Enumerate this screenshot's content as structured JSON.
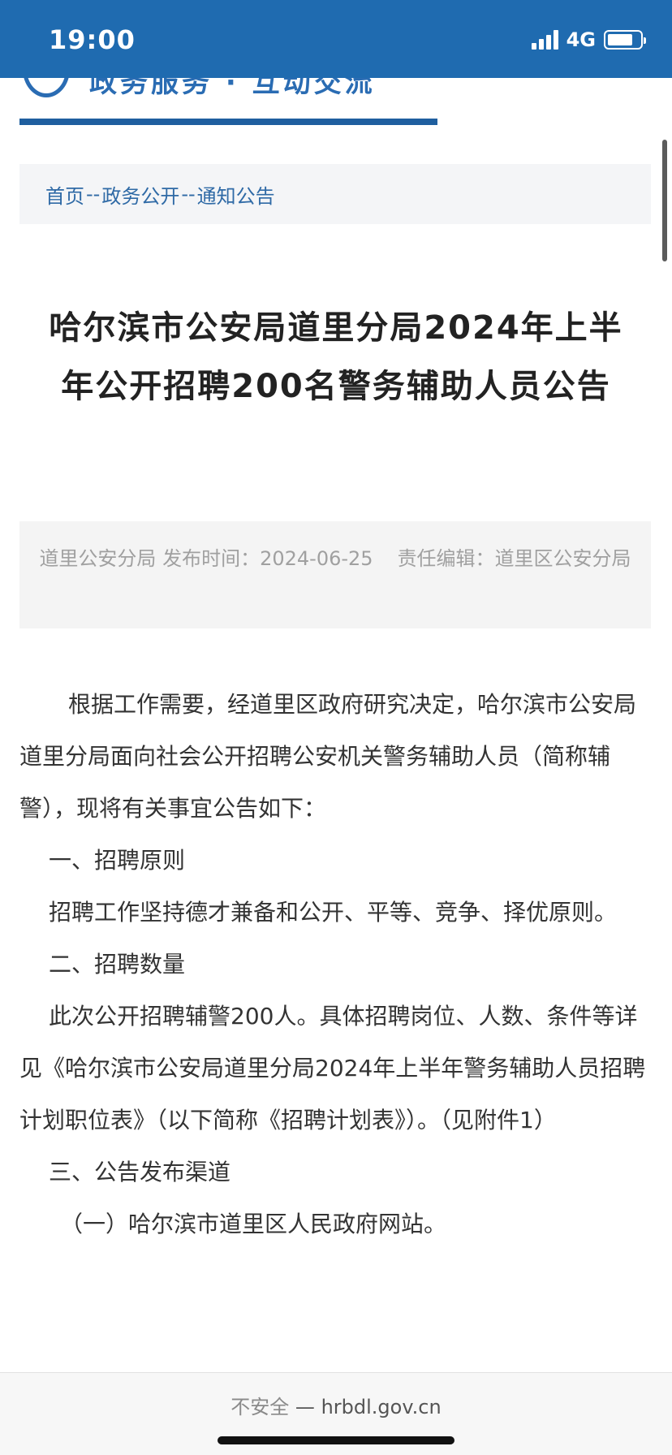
{
  "status_bar": {
    "time": "19:00",
    "network": "4G",
    "battery_level": 0.8,
    "background_color": "#1f6bb0"
  },
  "header": {
    "accent_color": "#1f5f9f"
  },
  "breadcrumb": {
    "items": [
      "首页",
      "政务公开",
      "通知公告"
    ],
    "separator": "--"
  },
  "article": {
    "title": "哈尔滨市公安局道里分局2024年上半年公开招聘200名警务辅助人员公告",
    "meta": {
      "source": "道里公安分局",
      "publish_label": "发布时间：",
      "publish_date": "2024-06-25",
      "editor_label": "责任编辑：",
      "editor": "道里区公安分局"
    },
    "paragraphs": [
      "根据工作需要，经道里区政府研究决定，哈尔滨市公安局道里分局面向社会公开招聘公安机关警务辅助人员（简称辅警），现将有关事宜公告如下：",
      "一、招聘原则",
      "招聘工作坚持德才兼备和公开、平等、竞争、择优原则。",
      "二、招聘数量",
      "此次公开招聘辅警200人。具体招聘岗位、人数、条件等详见《哈尔滨市公安局道里分局2024年上半年警务辅助人员招聘计划职位表》（以下简称《招聘计划表》）。（见附件1）",
      "三、公告发布渠道",
      "（一）哈尔滨市道里区人民政府网站。"
    ]
  },
  "browser": {
    "insecure_label": "不安全",
    "dash": "—",
    "domain": "hrbdl.gov.cn"
  }
}
